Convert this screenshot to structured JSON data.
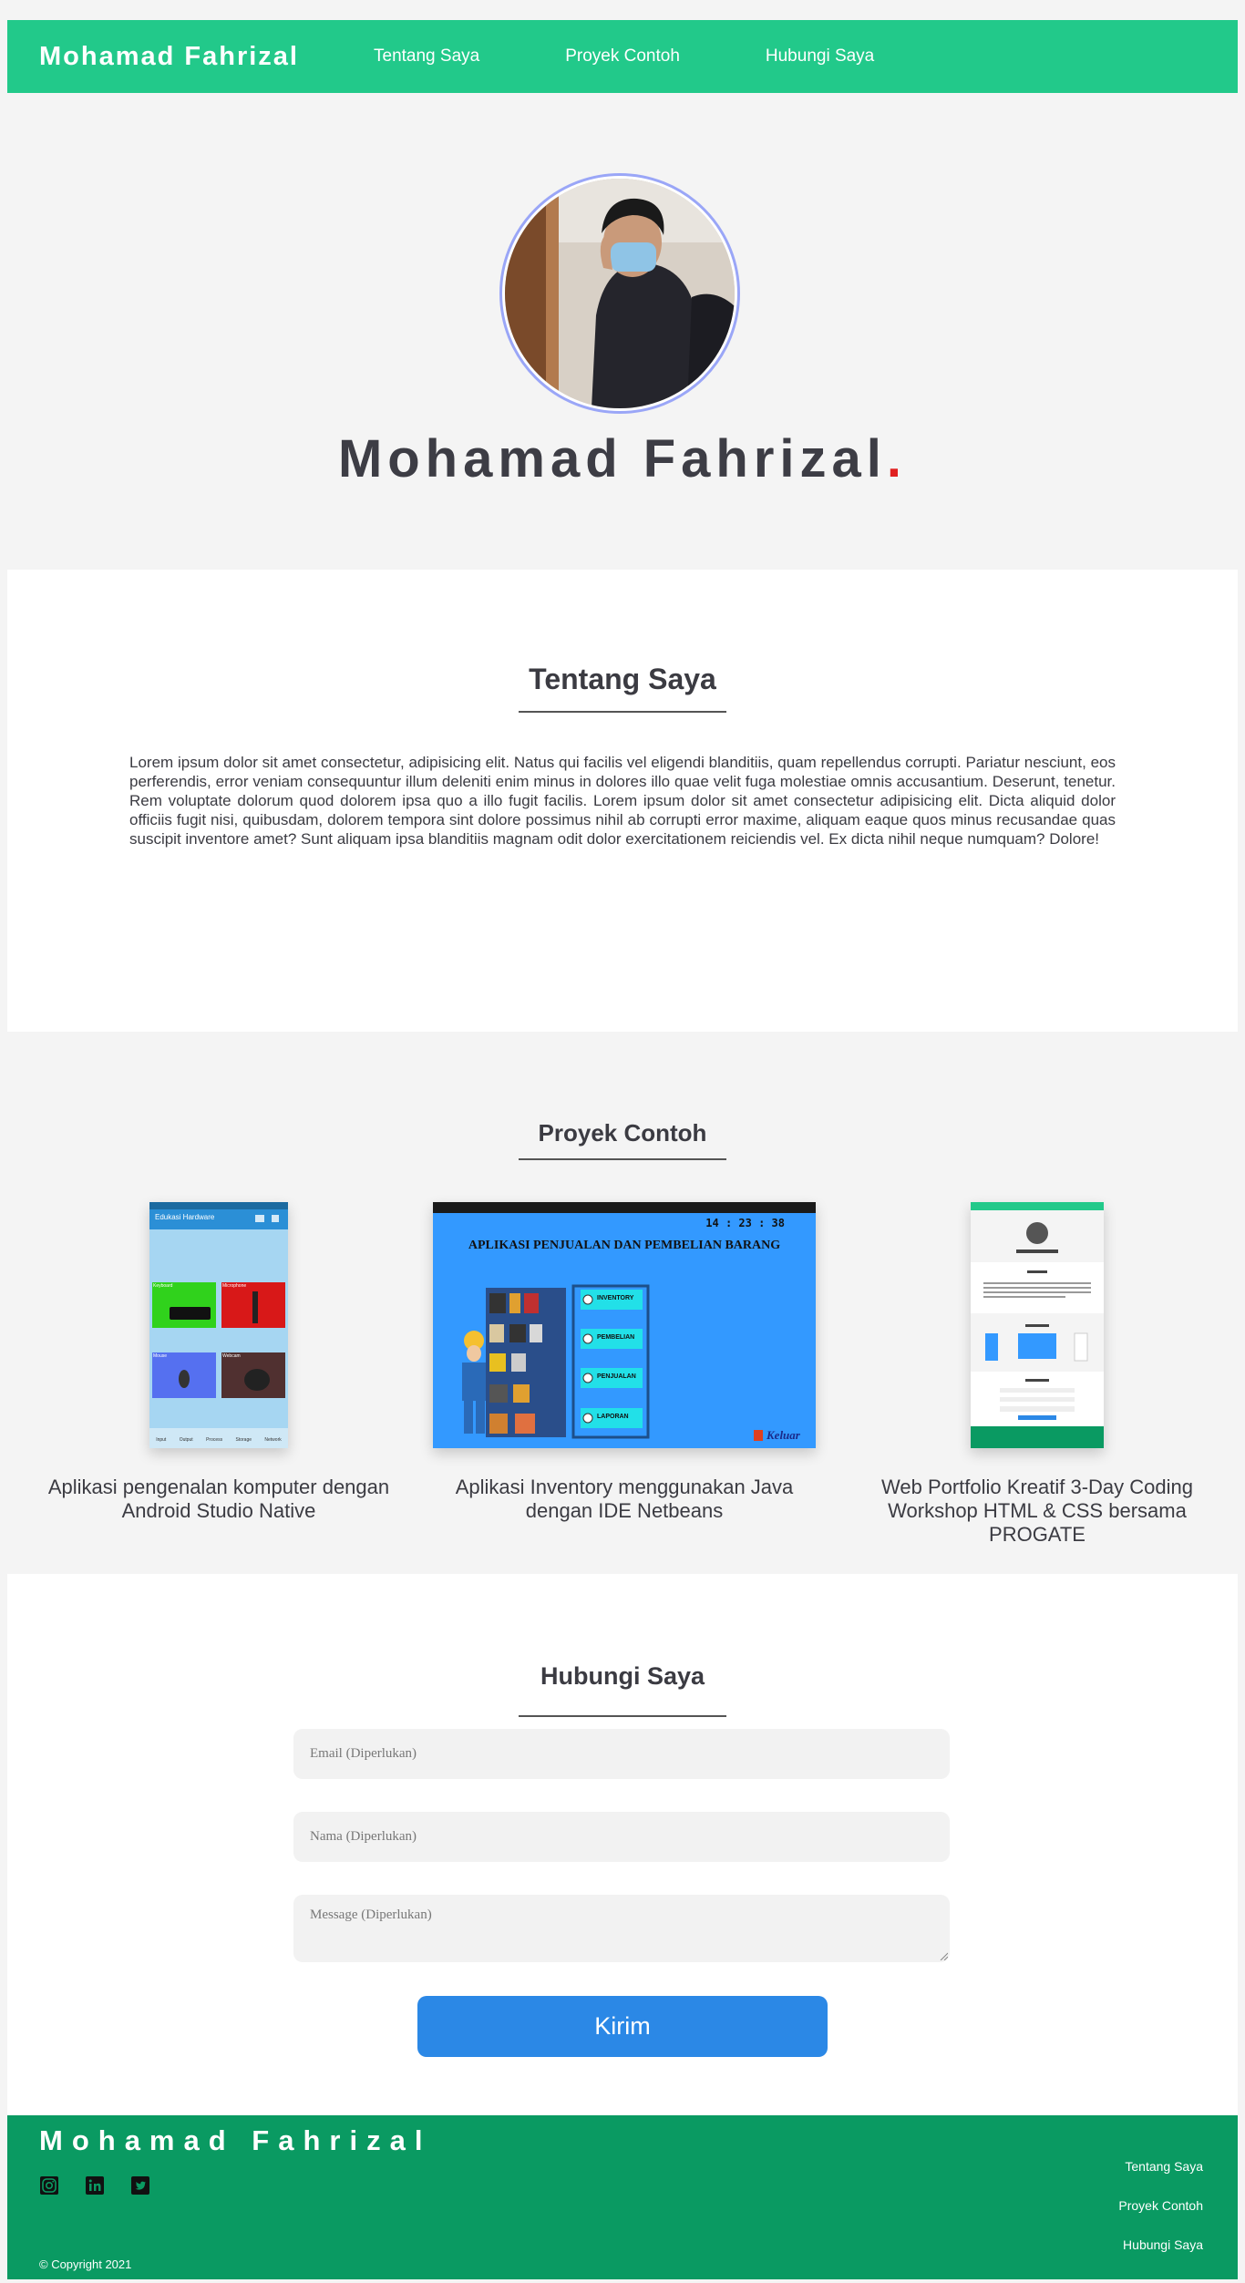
{
  "nav": {
    "brand": "Mohamad Fahrizal",
    "links": [
      "Tentang Saya",
      "Proyek Contoh",
      "Hubungi Saya"
    ]
  },
  "hero": {
    "name": "Mohamad Fahrizal",
    "dot": "."
  },
  "about": {
    "title": "Tentang Saya",
    "body": "Lorem ipsum dolor sit amet consectetur, adipisicing elit. Natus qui facilis vel eligendi blanditiis, quam repellendus corrupti. Pariatur nesciunt, eos perferendis, error veniam consequuntur illum deleniti enim minus in dolores illo quae velit fuga molestiae omnis accusantium. Deserunt, tenetur. Rem voluptate dolorum quod dolorem ipsa quo a illo fugit facilis. Lorem ipsum dolor sit amet consectetur adipisicing elit. Dicta aliquid dolor officiis fugit nisi, quibusdam, dolorem tempora sint dolore possimus nihil ab corrupti error maxime, aliquam eaque quos minus recusandae quas suscipit inventore amet? Sunt aliquam ipsa blanditiis magnam odit dolor exercitationem reiciendis vel. Ex dicta nihil neque numquam? Dolore!"
  },
  "projects": {
    "title": "Proyek Contoh",
    "items": [
      {
        "caption": "Aplikasi pengenalan komputer dengan Android Studio Native",
        "app_title": "Edukasi Hardware",
        "tiles": [
          "Keyboard",
          "Microphone",
          "Mouse",
          "Webcam"
        ],
        "nav_tabs": [
          "Input",
          "Output",
          "Process",
          "Storage",
          "Network"
        ]
      },
      {
        "caption": "Aplikasi Inventory menggunakan Java dengan IDE Netbeans",
        "clock": "14 : 23 : 38",
        "heading": "APLIKASI PENJUALAN DAN PEMBELIAN BARANG",
        "menu": [
          "INVENTORY",
          "PEMBELIAN",
          "PENJUALAN",
          "LAPORAN"
        ],
        "exit": "Keluar"
      },
      {
        "caption": "Web Portfolio Kreatif 3-Day Coding Workshop HTML & CSS bersama PROGATE"
      }
    ]
  },
  "contact": {
    "title": "Hubungi Saya",
    "email_placeholder": "Email (Diperlukan)",
    "name_placeholder": "Nama (Diperlukan)",
    "message_placeholder": "Message (Diperlukan)",
    "submit": "Kirim"
  },
  "footer": {
    "brand": "Mohamad Fahrizal",
    "copyright": "© Copyright 2021",
    "links": [
      "Tentang Saya",
      "Proyek Contoh",
      "Hubungi Saya"
    ],
    "icons": [
      "instagram-icon",
      "linkedin-icon",
      "twitter-icon"
    ]
  },
  "colors": {
    "nav": "#22c98a",
    "footer": "#0a9a62",
    "button": "#2b88e6",
    "accent_dot": "#e02020"
  }
}
